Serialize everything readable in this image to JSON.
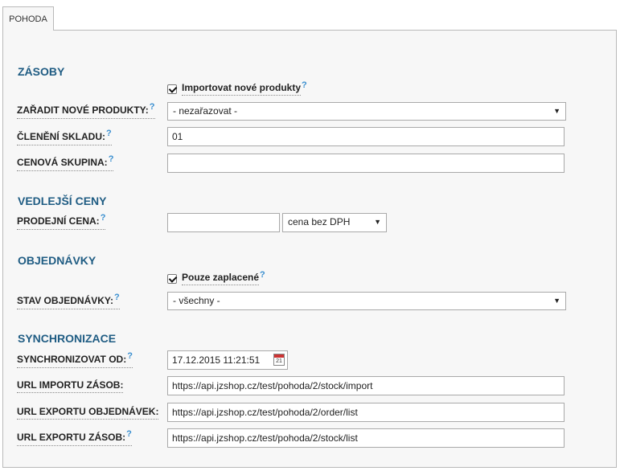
{
  "tab": {
    "label": "POHODA"
  },
  "sections": {
    "zasoby": "ZÁSOBY",
    "vedlejsi_ceny": "VEDLEJŠÍ CENY",
    "objednavky": "OBJEDNÁVKY",
    "synchronizace": "SYNCHRONIZACE"
  },
  "help_mark": "?",
  "zasoby": {
    "import_new": {
      "label": "Importovat nové produkty",
      "checked": true
    },
    "zaradit": {
      "label": "ZAŘADIT NOVÉ PRODUKTY:",
      "value": "- nezařazovat -"
    },
    "cleneni": {
      "label": "ČLENĚNÍ SKLADU:",
      "value": "01"
    },
    "cenova": {
      "label": "CENOVÁ SKUPINA:",
      "value": ""
    }
  },
  "vedlejsi_ceny": {
    "prodejni": {
      "label": "PRODEJNÍ CENA:",
      "value": "",
      "mode": "cena bez DPH"
    }
  },
  "objednavky": {
    "paid_only": {
      "label": "Pouze zaplacené",
      "checked": true
    },
    "stav": {
      "label": "STAV OBJEDNÁVKY:",
      "value": "- všechny -"
    }
  },
  "synchronizace": {
    "od": {
      "label": "SYNCHRONIZOVAT OD:",
      "value": "17.12.2015 11:21:51",
      "calendar_day": "21"
    },
    "url_import_zasob": {
      "label": "URL IMPORTU ZÁSOB:",
      "value": "https://api.jzshop.cz/test/pohoda/2/stock/import"
    },
    "url_export_obj": {
      "label": "URL EXPORTU OBJEDNÁVEK:",
      "value": "https://api.jzshop.cz/test/pohoda/2/order/list"
    },
    "url_export_zasob": {
      "label": "URL EXPORTU ZÁSOB:",
      "value": "https://api.jzshop.cz/test/pohoda/2/stock/list"
    }
  }
}
